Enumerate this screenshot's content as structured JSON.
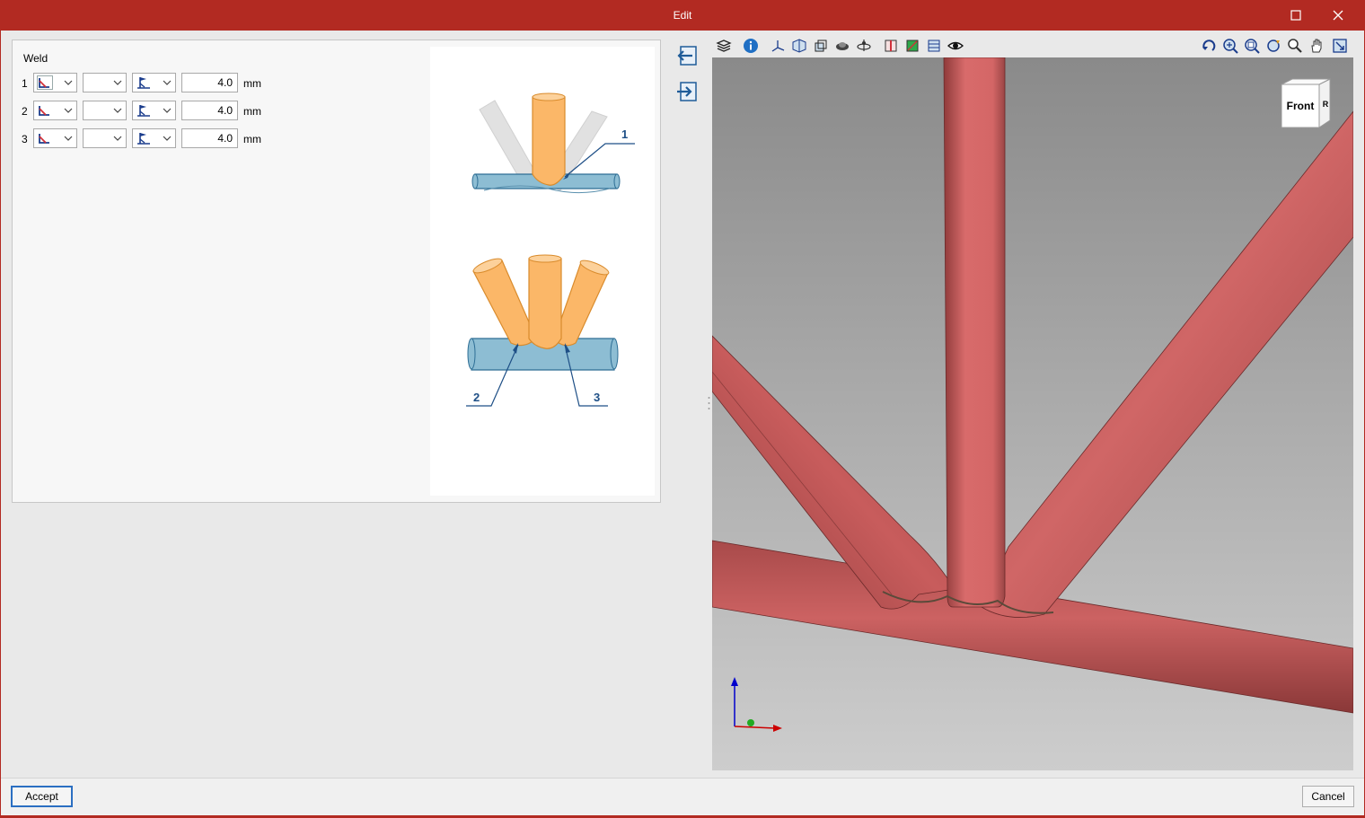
{
  "window": {
    "title": "Edit",
    "accent": "#b22a22"
  },
  "weld": {
    "section_title": "Weld",
    "unit": "mm",
    "rows": [
      {
        "index": "1",
        "value": "4.0"
      },
      {
        "index": "2",
        "value": "4.0"
      },
      {
        "index": "3",
        "value": "4.0"
      }
    ]
  },
  "illustration": {
    "callouts": [
      "1",
      "2",
      "3"
    ],
    "base_tube_color": "#8dbdd3",
    "member_tube_color": "#fbb768"
  },
  "viewport": {
    "view_cube_label": "Front",
    "view_cube_side_label": "R",
    "background_top": "#8a8a8a",
    "background_bottom": "#cdcdcd",
    "member_color": "#c86060"
  },
  "toolbar": {
    "icons": [
      "layers-icon",
      "info-icon",
      "axes-icon",
      "solid-view-icon",
      "box-view-icon",
      "render-icon",
      "orbit-icon",
      "section-icon",
      "grid-view-icon",
      "table-view-icon",
      "visibility-icon"
    ],
    "right_icons": [
      "rotate-view-icon",
      "zoom-all-icon",
      "zoom-window-icon",
      "refresh-view-icon",
      "zoom-icon",
      "pan-icon",
      "fit-view-icon"
    ]
  },
  "buttons": {
    "accept": "Accept",
    "cancel": "Cancel"
  }
}
